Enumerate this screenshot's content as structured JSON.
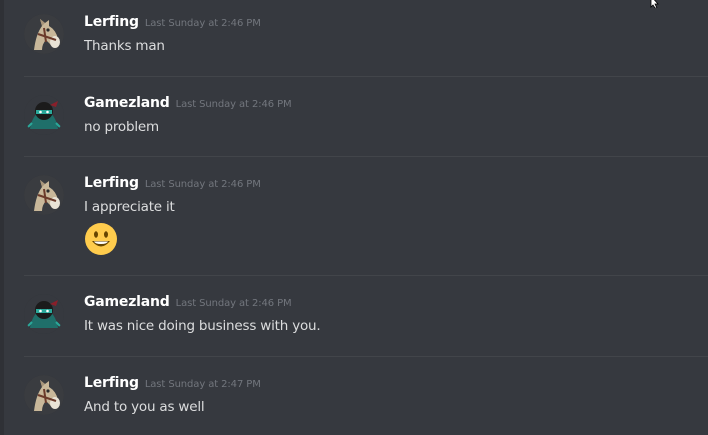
{
  "messages": [
    {
      "username": "Lerfing",
      "timestamp": "Last Sunday at 2:46 PM",
      "text": "Thanks man"
    },
    {
      "username": "Gamezland",
      "timestamp": "Last Sunday at 2:46 PM",
      "text": "no problem"
    },
    {
      "username": "Lerfing",
      "timestamp": "Last Sunday at 2:46 PM",
      "text": "I appreciate it",
      "emoji": "smiley-emoji"
    },
    {
      "username": "Gamezland",
      "timestamp": "Last Sunday at 2:46 PM",
      "text": "It was nice doing business with you."
    },
    {
      "username": "Lerfing",
      "timestamp": "Last Sunday at 2:47 PM",
      "text": "And to you as well"
    }
  ],
  "colors": {
    "background": "#36393f",
    "username": "#ffffff",
    "timestamp": "#72767d",
    "text": "#dcddde",
    "divider": "#42454a"
  },
  "icons": [
    "horse-avatar-icon",
    "ninja-avatar-icon",
    "smiley-emoji",
    "cursor-icon"
  ]
}
